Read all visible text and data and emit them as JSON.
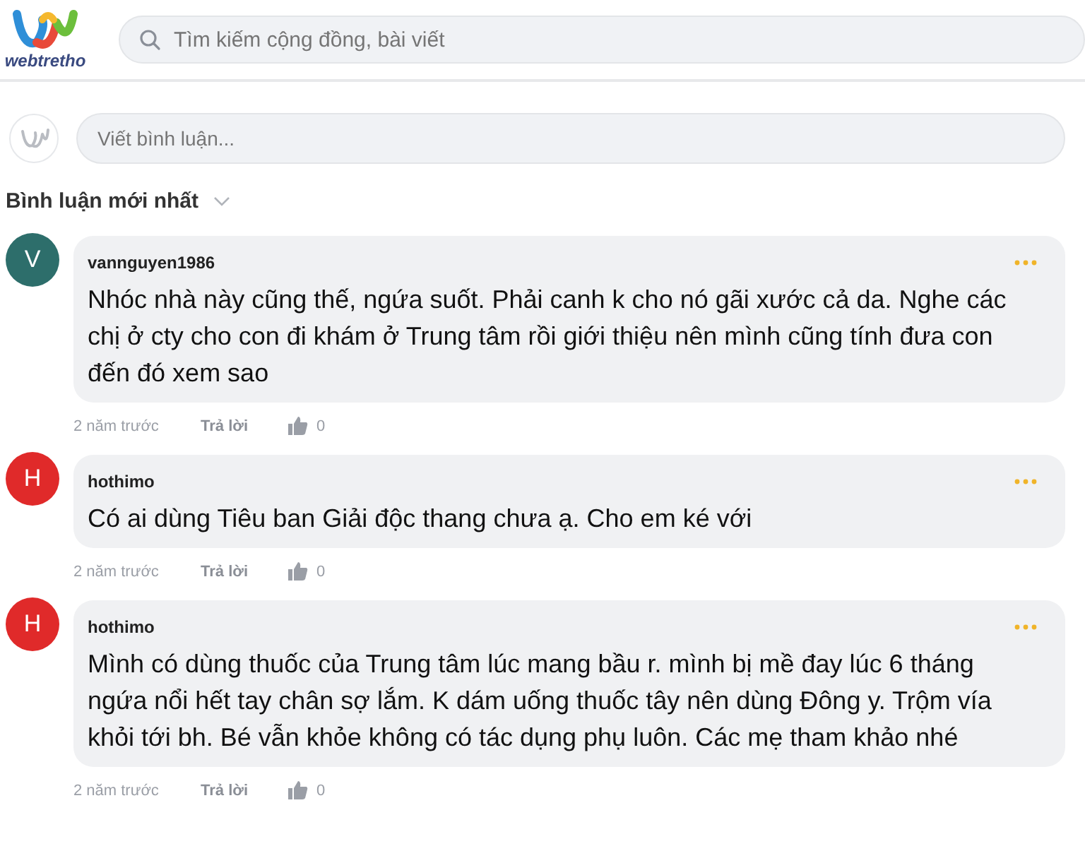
{
  "header": {
    "logo_text": "webtretho",
    "search": {
      "placeholder": "Tìm kiếm cộng đồng, bài viết"
    }
  },
  "composer": {
    "placeholder": "Viết bình luận..."
  },
  "sort": {
    "label": "Bình luận mới nhất"
  },
  "comments": [
    {
      "avatar_letter": "V",
      "color": "#2d6e6b",
      "author": "vannguyen1986",
      "text": "Nhóc nhà này cũng thế, ngứa suốt. Phải canh k cho nó gãi xước cả da. Nghe các chị ở cty cho con đi khám ở Trung tâm rồi giới thiệu nên mình cũng tính đưa con đến đó xem sao",
      "time": "2 năm trước",
      "reply": "Trả lời",
      "likes": "0"
    },
    {
      "avatar_letter": "H",
      "color": "#e02a2a",
      "author": "hothimo",
      "text": "Có ai dùng Tiêu ban Giải độc thang chưa ạ. Cho em ké với",
      "time": "2 năm trước",
      "reply": "Trả lời",
      "likes": "0"
    },
    {
      "avatar_letter": "H",
      "color": "#e02a2a",
      "author": "hothimo",
      "text": "Mình có dùng thuốc của Trung tâm lúc mang bầu r. mình bị mề đay lúc 6 tháng ngứa nổi hết tay chân sợ lắm. K dám uống thuốc tây nên dùng Đông y. Trộm vía khỏi tới bh. Bé vẫn khỏe không có tác dụng phụ luôn. Các mẹ tham khảo nhé",
      "time": "2 năm trước",
      "reply": "Trả lời",
      "likes": "0"
    }
  ]
}
